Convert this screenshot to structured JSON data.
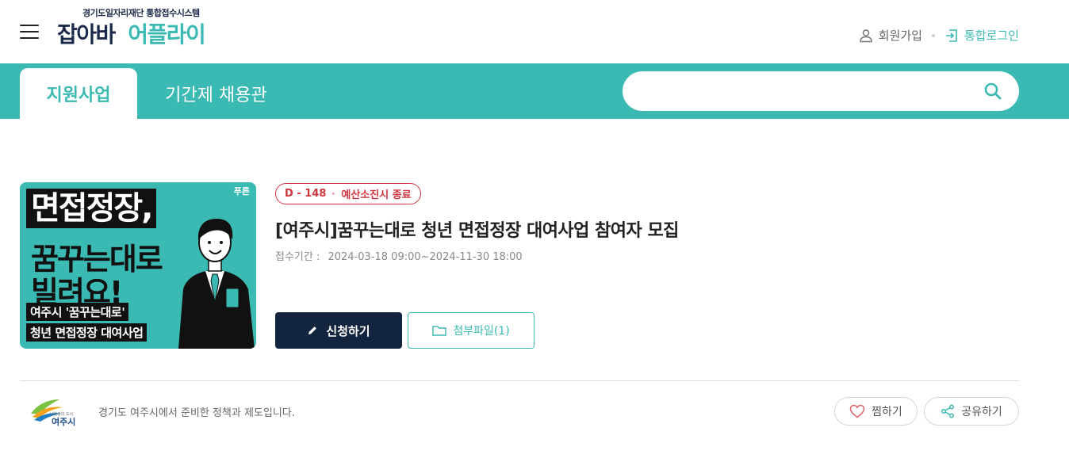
{
  "header": {
    "logo_subtitle": "경기도일자리재단 통합접수시스템",
    "logo_part1": "잡아바",
    "logo_part2": "어플라이",
    "signup_label": "회원가입",
    "login_label": "통합로그인"
  },
  "nav": {
    "tabs": [
      {
        "label": "지원사업",
        "active": true
      },
      {
        "label": "기간제 채용관",
        "active": false
      }
    ],
    "search": {
      "value": "",
      "placeholder": ""
    }
  },
  "program": {
    "dday": "D - 148",
    "status": "예산소진시 종료",
    "title": "[여주시]꿈꾸는대로 청년 면접정장 대여사업 참여자 모집",
    "period_label": "접수기간 :",
    "period_value": "2024-03-18 09:00~2024-11-30 18:00",
    "apply_label": "신청하기",
    "files_label": "첨부파일(1)",
    "poster": {
      "line1": "면접정장,",
      "line2": "꿈꾸는대로",
      "line3": "빌려요!",
      "line4": "여주시 '꿈꾸는대로'",
      "line5": "청년 면접정장 대여사업",
      "brand": "푸른"
    }
  },
  "footer": {
    "org_name": "여주시",
    "org_slogan": "남한강의 도시",
    "description": "경기도 여주시에서 준비한 정책과 제도입니다.",
    "like_label": "찜하기",
    "share_label": "공유하기"
  },
  "colors": {
    "teal": "#3bbab3",
    "navy": "#13243f",
    "badge_red": "#d0353f"
  }
}
